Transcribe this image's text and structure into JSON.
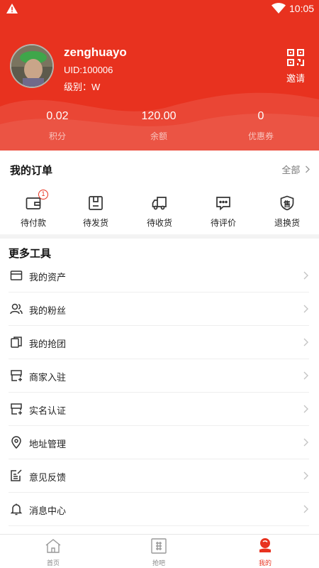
{
  "status_bar": {
    "time": "10:05"
  },
  "profile": {
    "username": "zenghuayo",
    "uid": "UID:100006",
    "level": "级别：W",
    "invite_label": "邀请"
  },
  "stats": [
    {
      "value": "0.02",
      "label": "积分"
    },
    {
      "value": "120.00",
      "label": "余额"
    },
    {
      "value": "0",
      "label": "优惠券"
    }
  ],
  "orders": {
    "title": "我的订单",
    "all_label": "全部",
    "items": [
      {
        "label": "待付款",
        "icon": "wallet-icon",
        "badge": "1"
      },
      {
        "label": "待发货",
        "icon": "box-icon"
      },
      {
        "label": "待收货",
        "icon": "truck-icon"
      },
      {
        "label": "待评价",
        "icon": "comment-icon"
      },
      {
        "label": "退换货",
        "icon": "return-shield-icon",
        "icon_text": "售"
      }
    ]
  },
  "tools": {
    "title": "更多工具",
    "items": [
      {
        "label": "我的资产",
        "icon": "card-icon"
      },
      {
        "label": "我的粉丝",
        "icon": "users-icon"
      },
      {
        "label": "我的抢团",
        "icon": "group-icon"
      },
      {
        "label": "商家入驻",
        "icon": "store-icon"
      },
      {
        "label": "实名认证",
        "icon": "id-card-icon"
      },
      {
        "label": "地址管理",
        "icon": "location-icon"
      },
      {
        "label": "意见反馈",
        "icon": "feedback-icon"
      },
      {
        "label": "消息中心",
        "icon": "bell-icon"
      }
    ]
  },
  "tabbar": [
    {
      "label": "首页",
      "icon": "home-icon",
      "active": false
    },
    {
      "label": "抢吧",
      "icon": "grid-icon",
      "active": false
    },
    {
      "label": "我的",
      "icon": "profile-icon",
      "active": true
    }
  ],
  "colors": {
    "primary": "#e8321f",
    "text": "#222222",
    "muted": "#888888"
  }
}
